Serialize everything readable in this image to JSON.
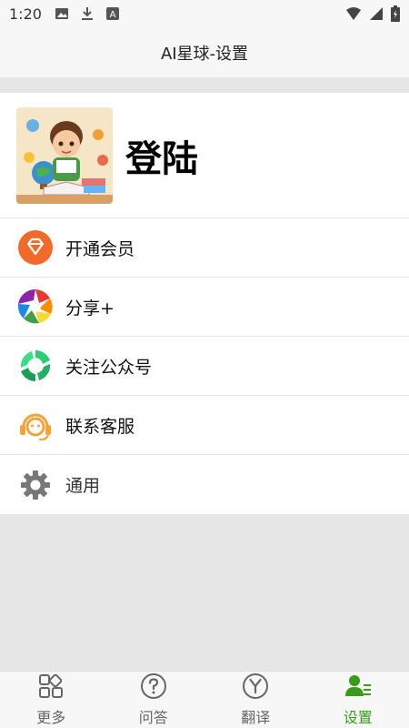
{
  "status_bar": {
    "time": "1:20"
  },
  "header": {
    "title": "AI星球-设置"
  },
  "profile": {
    "login_label": "登陆"
  },
  "menu": {
    "items": [
      {
        "label": "开通会员",
        "icon": "diamond-icon"
      },
      {
        "label": "分享+",
        "icon": "share-aperture-icon"
      },
      {
        "label": "关注公众号",
        "icon": "wechat-official-icon"
      },
      {
        "label": "联系客服",
        "icon": "customer-service-icon"
      },
      {
        "label": "通用",
        "icon": "gear-icon"
      }
    ]
  },
  "bottom_nav": {
    "items": [
      {
        "label": "更多",
        "icon": "apps-grid-icon",
        "active": false
      },
      {
        "label": "问答",
        "icon": "question-circle-icon",
        "active": false
      },
      {
        "label": "翻译",
        "icon": "y-circle-icon",
        "active": false
      },
      {
        "label": "设置",
        "icon": "user-settings-icon",
        "active": true
      }
    ]
  },
  "colors": {
    "accent_green": "#3a9a1a",
    "vip_orange": "#f06a2a",
    "service_orange": "#f2a33a"
  }
}
